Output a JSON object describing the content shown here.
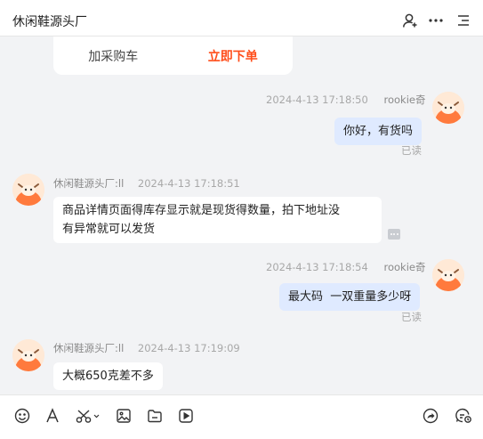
{
  "header": {
    "title": "休闲鞋源头厂"
  },
  "card_actions": {
    "add_to_cart": "加采购车",
    "order_now": "立即下单"
  },
  "messages": [
    {
      "side": "me",
      "time": "2024-4-13 17:18:50",
      "name": "rookie奇",
      "text": "你好，有货吗",
      "status": "已读"
    },
    {
      "side": "them",
      "name": "休闲鞋源头厂:ll",
      "time": "2024-4-13 17:18:51",
      "line1": "商品详情页面得库存显示就是现货得数量，拍下地址没",
      "line2": "有异常就可以发货"
    },
    {
      "side": "me",
      "time": "2024-4-13 17:18:54",
      "name": "rookie奇",
      "text": "最大码  一双重量多少呀",
      "status": "已读"
    },
    {
      "side": "them",
      "name": "休闲鞋源头厂:ll",
      "time": "2024-4-13 17:19:09",
      "text": "大概650克差不多"
    }
  ],
  "colors": {
    "accent": "#ff4d1a",
    "my_bubble": "#dfeaff",
    "chat_bg": "#f2f3f5"
  }
}
